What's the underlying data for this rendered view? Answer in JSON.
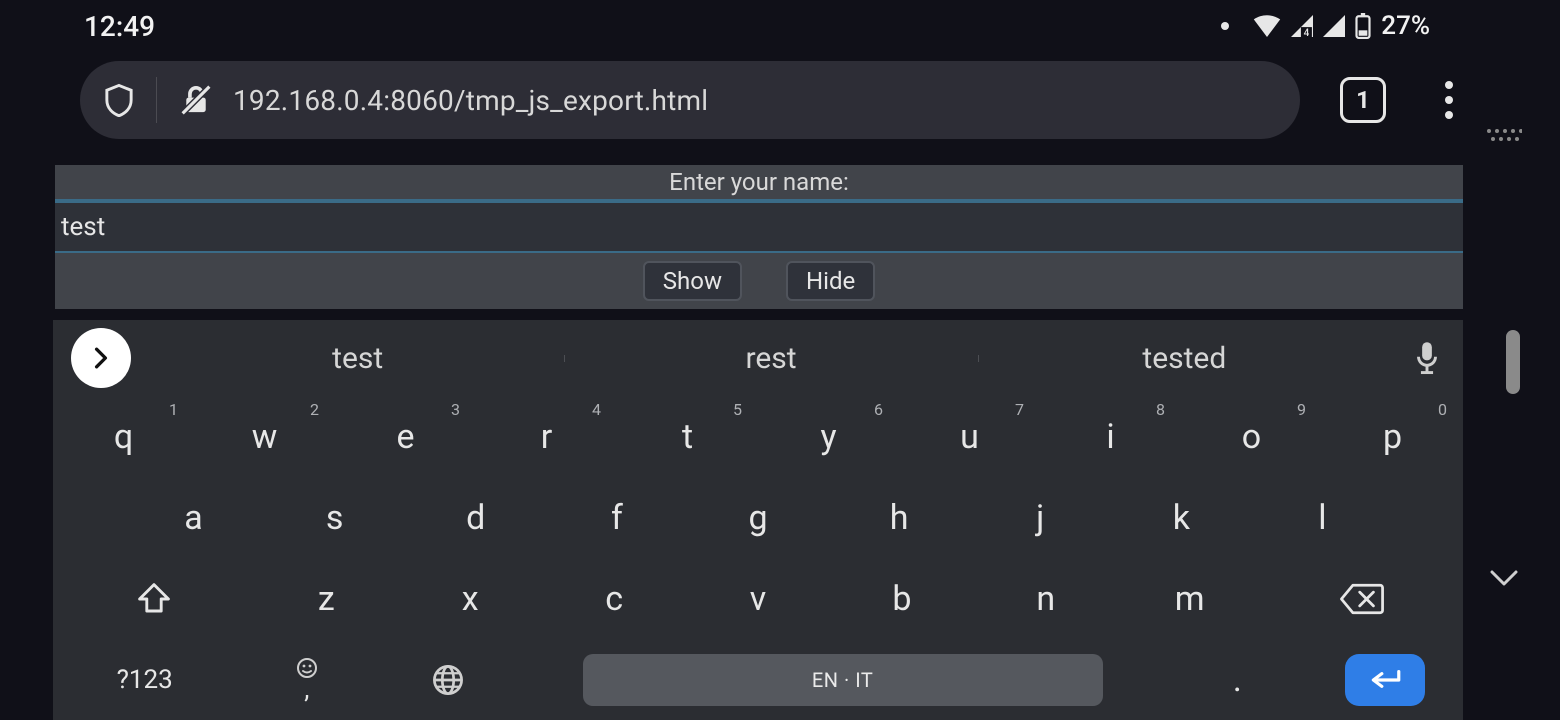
{
  "statusbar": {
    "time": "12:49",
    "battery_text": "27%"
  },
  "browser": {
    "url": "192.168.0.4:8060/tmp_js_export.html",
    "tab_count": "1"
  },
  "page": {
    "label": "Enter your name:",
    "input_value": "test",
    "show_label": "Show",
    "hide_label": "Hide"
  },
  "keyboard": {
    "suggestions": [
      "test",
      "rest",
      "tested"
    ],
    "row1": [
      {
        "k": "q",
        "n": "1"
      },
      {
        "k": "w",
        "n": "2"
      },
      {
        "k": "e",
        "n": "3"
      },
      {
        "k": "r",
        "n": "4"
      },
      {
        "k": "t",
        "n": "5"
      },
      {
        "k": "y",
        "n": "6"
      },
      {
        "k": "u",
        "n": "7"
      },
      {
        "k": "i",
        "n": "8"
      },
      {
        "k": "o",
        "n": "9"
      },
      {
        "k": "p",
        "n": "0"
      }
    ],
    "row2": [
      "a",
      "s",
      "d",
      "f",
      "g",
      "h",
      "j",
      "k",
      "l"
    ],
    "row3": [
      "z",
      "x",
      "c",
      "v",
      "b",
      "n",
      "m"
    ],
    "sym_label": "?123",
    "comma": ",",
    "period": ".",
    "space_label": "EN · IT"
  }
}
